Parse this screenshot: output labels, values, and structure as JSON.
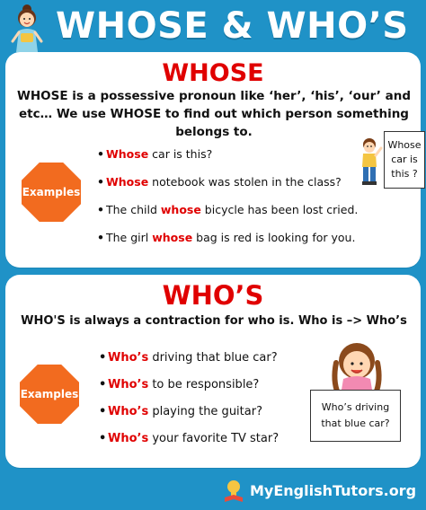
{
  "header": {
    "title": "WHOSE & WHO’S"
  },
  "whose": {
    "heading": "WHOSE",
    "definition": "WHOSE is a possessive pronoun like ‘her’, ‘his’, ‘our’ and etc… We use WHOSE to find out which person something belongs to.",
    "examples_label": "Examples",
    "examples": [
      {
        "kw": "Whose",
        "pre": "",
        "post": " car is this?"
      },
      {
        "kw": "Whose",
        "pre": "",
        "post": " notebook was stolen in the class?"
      },
      {
        "kw": "whose",
        "pre": "The child ",
        "post": " bicycle has been lost cried."
      },
      {
        "kw": "whose",
        "pre": "The girl ",
        "post": " bag is red is looking for you."
      }
    ],
    "speech_box": "Whose car is this ?"
  },
  "whos": {
    "heading": "WHO’S",
    "definition": "WHO'S is always a contraction for who is. Who is –> Who’s",
    "examples_label": "Examples",
    "examples": [
      {
        "kw": "Who’s",
        "pre": "",
        "post": " driving that blue car?"
      },
      {
        "kw": "Who’s",
        "pre": "",
        "post": " to be responsible?"
      },
      {
        "kw": "Who’s",
        "pre": "",
        "post": " playing the guitar?"
      },
      {
        "kw": "Who’s",
        "pre": "",
        "post": " your favorite TV star?"
      }
    ],
    "speech_box": "Who’s driving that blue car?"
  },
  "footer": {
    "brand": "MyEnglishTutors.org"
  },
  "colors": {
    "background": "#1f92c7",
    "accent_red": "#e00000",
    "octagon_orange": "#f26b1f"
  },
  "icons": {
    "header_figure": "girl-teacher-icon",
    "panel1_figure": "boy-icon",
    "panel2_figure": "girl-icon",
    "footer_logo": "lightbulb-book-icon"
  }
}
